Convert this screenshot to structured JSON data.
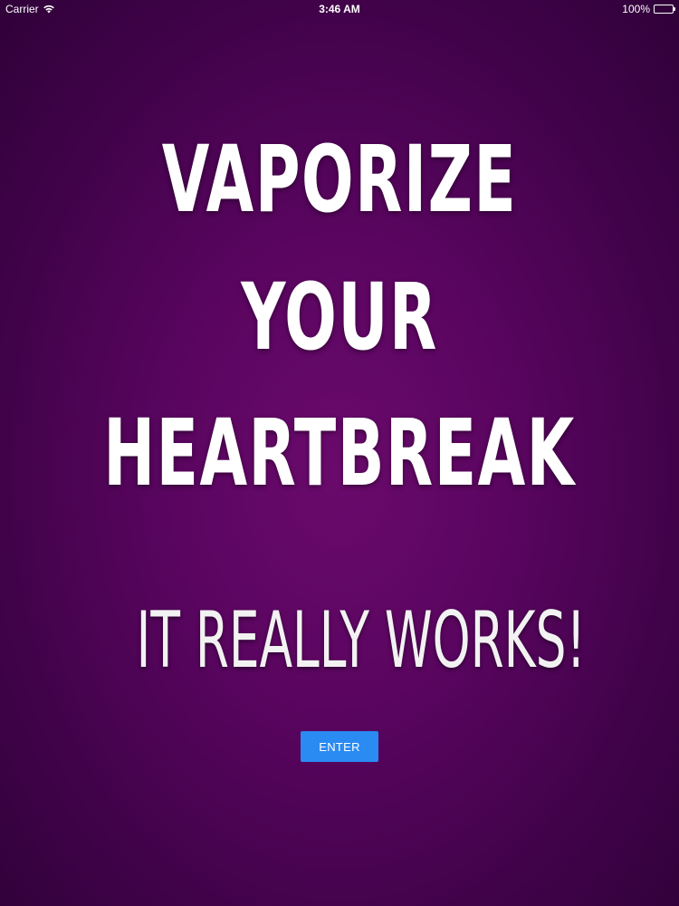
{
  "status_bar": {
    "carrier": "Carrier",
    "time": "3:46 AM",
    "battery": "100%",
    "battery_level": 1.0,
    "icons": [
      "wifi-icon",
      "battery-icon"
    ]
  },
  "headline": {
    "line1": "VAPORIZE",
    "line2": "YOUR",
    "line3": "HEARTBREAK"
  },
  "tagline": "IT REALLY WORKS!",
  "enter_button": {
    "label": "ENTER"
  },
  "colors": {
    "background_center": "#6a0a6c",
    "background_edge": "#300139",
    "button": "#2a8bf2",
    "text": "#ffffff"
  }
}
